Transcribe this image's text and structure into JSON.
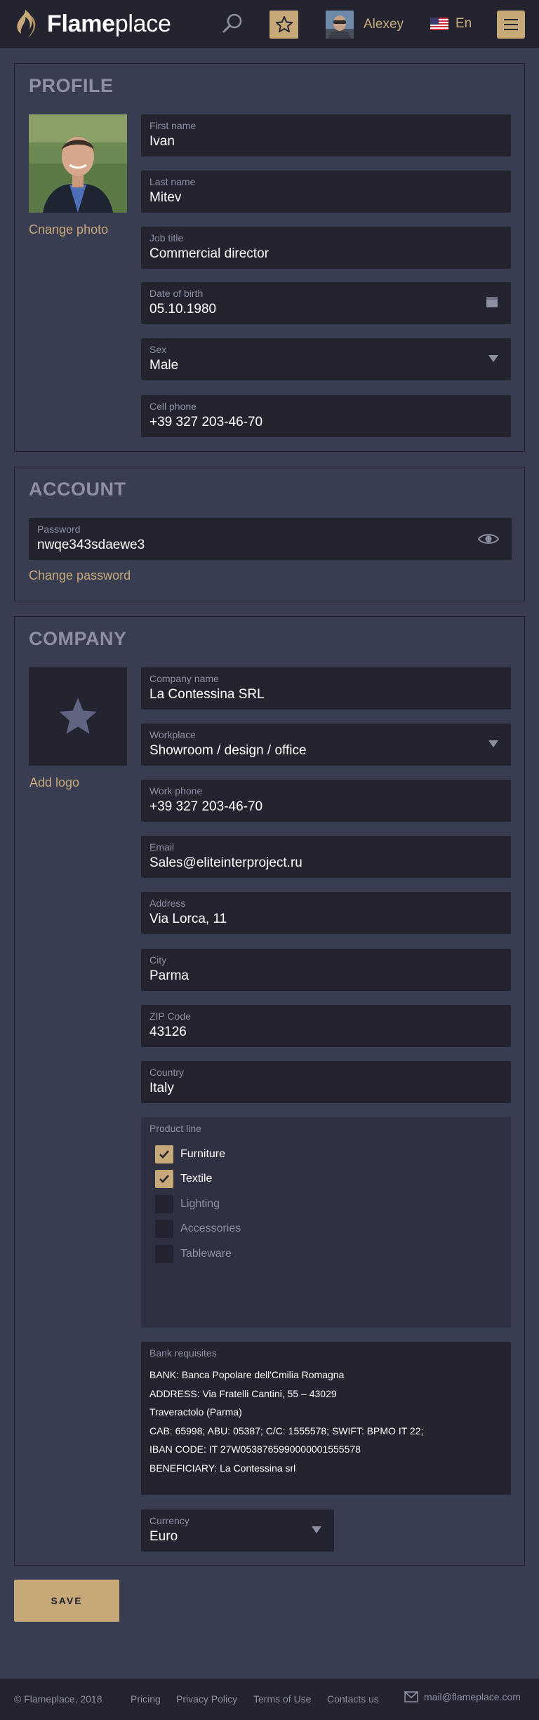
{
  "brand": {
    "name_bold": "Flame",
    "name_light": "place"
  },
  "header": {
    "user_name": "Alexey",
    "language": "En"
  },
  "profile": {
    "title": "PROFILE",
    "change_photo": "Cnange photo",
    "fields": {
      "first_name": {
        "label": "First name",
        "value": "Ivan"
      },
      "last_name": {
        "label": "Last name",
        "value": "Mitev"
      },
      "job_title": {
        "label": "Job title",
        "value": "Commercial director"
      },
      "dob": {
        "label": "Date of birth",
        "value": "05.10.1980"
      },
      "sex": {
        "label": "Sex",
        "value": "Male"
      },
      "cell_phone": {
        "label": "Cell phone",
        "value": "+39 327 203-46-70"
      }
    }
  },
  "account": {
    "title": "ACCOUNT",
    "password": {
      "label": "Password",
      "value": "nwqe343sdaewe3"
    },
    "change_password": "Change password"
  },
  "company": {
    "title": "COMPANY",
    "add_logo": "Add logo",
    "fields": {
      "company_name": {
        "label": "Company name",
        "value": "La Contessina SRL"
      },
      "workplace": {
        "label": "Workplace",
        "value": "Showroom / design / office"
      },
      "work_phone": {
        "label": "Work phone",
        "value": "+39 327 203-46-70"
      },
      "email": {
        "label": "Email",
        "value": "Sales@eliteinterproject.ru"
      },
      "address": {
        "label": "Address",
        "value": "Via Lorca, 11"
      },
      "city": {
        "label": "City",
        "value": "Parma"
      },
      "zip": {
        "label": "ZIP Code",
        "value": "43126"
      },
      "country": {
        "label": "Country",
        "value": "Italy"
      }
    },
    "product_line": {
      "label": "Product line",
      "items": [
        {
          "label": "Furniture",
          "checked": true
        },
        {
          "label": "Textile",
          "checked": true
        },
        {
          "label": "Lighting",
          "checked": false
        },
        {
          "label": "Accessories",
          "checked": false
        },
        {
          "label": "Tableware",
          "checked": false
        }
      ]
    },
    "bank": {
      "label": "Bank requisites",
      "lines": [
        "BANK: Banca Popolare dell'Cmilia Romagna",
        "ADDRESS: Via Fratelli Cantini, 55 – 43029",
        "Traveractolo (Parma)",
        "CAB: 65998; ABU: 05387; C/C: 1555578; SWIFT: BPMO IT 22;",
        "IBAN CODE: IT 27W0538765990000001555578",
        "BENEFICIARY: La Contessina srl"
      ]
    },
    "currency": {
      "label": "Currency",
      "value": "Euro"
    }
  },
  "save_label": "SAVE",
  "footer": {
    "copyright": "© Flameplace, 2018",
    "links": [
      "Pricing",
      "Privacy Policy",
      "Terms of Use",
      "Contacts us"
    ],
    "email": "mail@flameplace.com"
  },
  "colors": {
    "accent": "#c7a979",
    "header_bg": "#23242f",
    "page_bg": "#393d52",
    "field_bg": "#23242f",
    "muted_text": "#8d90a3"
  }
}
